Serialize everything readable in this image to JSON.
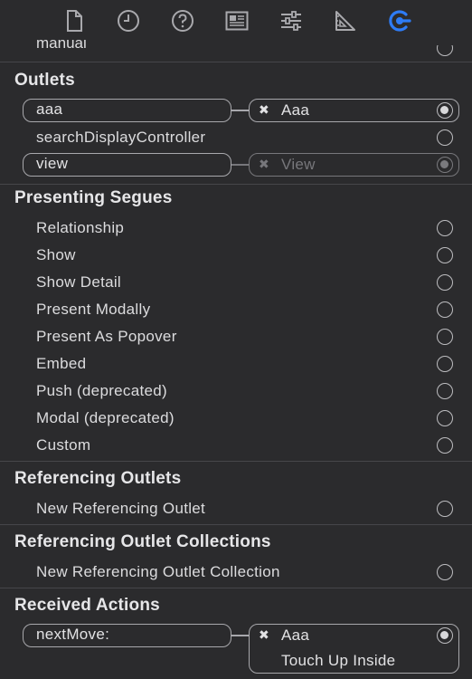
{
  "toolbar": {
    "icons": [
      "file-icon",
      "history-icon",
      "help-icon",
      "identity-icon",
      "attributes-icon",
      "size-icon",
      "connections-icon"
    ],
    "accent": "#2e7cf6"
  },
  "scrolled_item": {
    "label": "manual"
  },
  "outlets": {
    "title": "Outlets",
    "rows": [
      {
        "source": "aaa",
        "target": "Aaa"
      },
      {
        "label": "searchDisplayController"
      },
      {
        "source": "view",
        "target": "View"
      }
    ]
  },
  "segues": {
    "title": "Presenting Segues",
    "items": [
      "Relationship",
      "Show",
      "Show Detail",
      "Present Modally",
      "Present As Popover",
      "Embed",
      "Push (deprecated)",
      "Modal (deprecated)",
      "Custom"
    ]
  },
  "referencing_outlets": {
    "title": "Referencing Outlets",
    "item": "New Referencing Outlet"
  },
  "referencing_collections": {
    "title": "Referencing Outlet Collections",
    "item": "New Referencing Outlet Collection"
  },
  "received_actions": {
    "title": "Received Actions",
    "source": "nextMove:",
    "target": "Aaa",
    "event": "Touch Up Inside"
  },
  "remove_glyph": "✖"
}
